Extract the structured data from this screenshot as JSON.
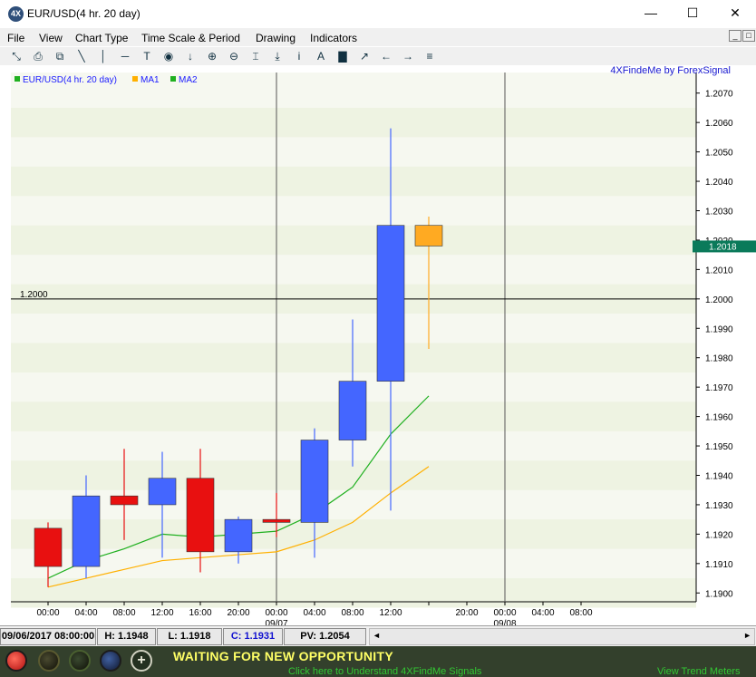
{
  "window": {
    "app_icon": "4X",
    "title": "EUR/USD(4 hr.  20 day)",
    "minimize": "—",
    "maximize": "☐",
    "close": "✕"
  },
  "menu": [
    "File",
    "View",
    "Chart Type",
    "Time Scale & Period",
    "Drawing",
    "Indicators"
  ],
  "toolbar_icons": [
    "cursor-icon",
    "print-icon",
    "copy-icon",
    "line-tool-icon",
    "vertical-line-icon",
    "horizontal-line-icon",
    "text-tool-icon",
    "target-icon",
    "down-arrow-icon",
    "zoom-in-icon",
    "zoom-out-icon",
    "fit-icon",
    "baseline-icon",
    "info-icon",
    "font-icon",
    "bar-chart-icon",
    "line-chart-icon",
    "scroll-left-icon",
    "scroll-right-icon",
    "chart-settings-icon"
  ],
  "brand": "4XFindeMe by ForexSignal",
  "legend": [
    {
      "label": "EUR/USD(4 hr.  20 day)",
      "color": "#20b020"
    },
    {
      "label": "MA1",
      "color": "#ffb000"
    },
    {
      "label": "MA2",
      "color": "#20b020"
    }
  ],
  "chart_data": {
    "type": "candlestick",
    "title": "EUR/USD(4 hr.  20 day)",
    "ylim": [
      1.1897,
      1.2077
    ],
    "y_ticks": [
      "1.1900",
      "1.1910",
      "1.1920",
      "1.1930",
      "1.1940",
      "1.1950",
      "1.1960",
      "1.1970",
      "1.1980",
      "1.1990",
      "1.2000",
      "1.2010",
      "1.2020",
      "1.2030",
      "1.2040",
      "1.2050",
      "1.2060",
      "1.2070"
    ],
    "x_ticks": [
      "00:00",
      "04:00",
      "08:00",
      "12:00",
      "16:00",
      "20:00",
      "00:00",
      "04:00",
      "08:00",
      "12:00",
      "",
      "20:00",
      "00:00",
      "04:00",
      "08:00"
    ],
    "date_labels": [
      {
        "tick_index": 6,
        "label": "09/07"
      },
      {
        "tick_index": 12,
        "label": "09/08"
      }
    ],
    "horizontal_line": {
      "value": 1.2,
      "label": "1.2000"
    },
    "current_price": "1.2018",
    "colors": {
      "up": "#4466ff",
      "down": "#e81010",
      "current": "#ffaa22",
      "ma1": "#ffb000",
      "ma2": "#20b020",
      "price_marker": "#0a7a5a"
    },
    "candles": [
      {
        "time": "00:00",
        "open": 1.1922,
        "high": 1.1924,
        "low": 1.1902,
        "close": 1.1909
      },
      {
        "time": "04:00",
        "open": 1.1909,
        "high": 1.194,
        "low": 1.1905,
        "close": 1.1933
      },
      {
        "time": "08:00",
        "open": 1.1933,
        "high": 1.1949,
        "low": 1.1918,
        "close": 1.193
      },
      {
        "time": "12:00",
        "open": 1.193,
        "high": 1.1948,
        "low": 1.1912,
        "close": 1.1939
      },
      {
        "time": "16:00",
        "open": 1.1939,
        "high": 1.1949,
        "low": 1.1907,
        "close": 1.1914
      },
      {
        "time": "20:00",
        "open": 1.1914,
        "high": 1.1926,
        "low": 1.191,
        "close": 1.1925
      },
      {
        "time": "00:00",
        "open": 1.1925,
        "high": 1.1934,
        "low": 1.1919,
        "close": 1.1924
      },
      {
        "time": "04:00",
        "open": 1.1924,
        "high": 1.1956,
        "low": 1.1912,
        "close": 1.1952
      },
      {
        "time": "08:00",
        "open": 1.1952,
        "high": 1.1993,
        "low": 1.1943,
        "close": 1.1972
      },
      {
        "time": "12:00",
        "open": 1.1972,
        "high": 1.2058,
        "low": 1.1928,
        "close": 1.2025
      },
      {
        "time": "16:00",
        "open": 1.2025,
        "high": 1.2028,
        "low": 1.1983,
        "close": 1.2018,
        "current": true
      }
    ],
    "series": [
      {
        "name": "MA1",
        "values": [
          1.1902,
          1.1905,
          1.1908,
          1.1911,
          1.1912,
          1.1913,
          1.1914,
          1.1918,
          1.1924,
          1.1934,
          1.1943
        ]
      },
      {
        "name": "MA2",
        "values": [
          1.1905,
          1.1911,
          1.1915,
          1.192,
          1.1919,
          1.192,
          1.1921,
          1.1927,
          1.1936,
          1.1954,
          1.1967
        ]
      }
    ]
  },
  "status": {
    "datetime": "09/06/2017 08:00:00",
    "high": "H: 1.1948",
    "low": "L: 1.1918",
    "close": "C: 1.1931",
    "pv": "PV: 1.2054",
    "scroll_left": "◄",
    "scroll_right": "►"
  },
  "bottom": {
    "waiting": "WAITING FOR NEW OPPORTUNITY",
    "click_here": "Click here to Understand 4XFindMe Signals",
    "view_trend_meters": "View Trend Meters",
    "add": "+"
  }
}
